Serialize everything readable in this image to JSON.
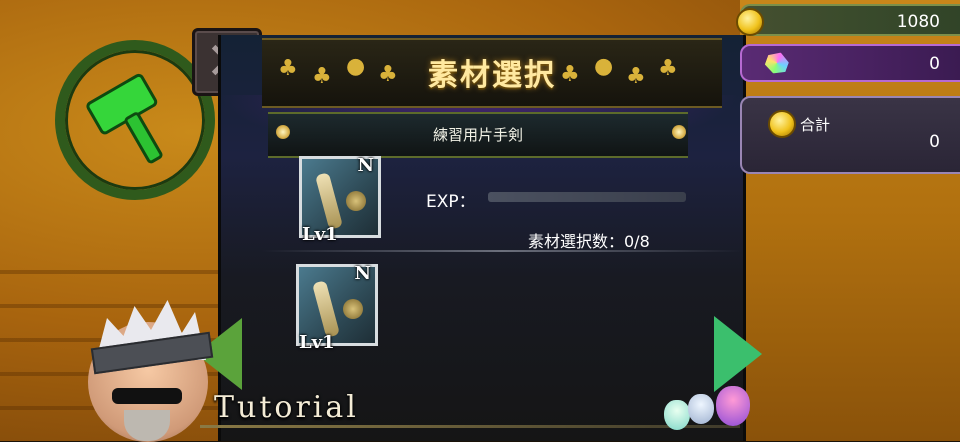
{
  "header": {
    "title": "素材選択",
    "close_icon": "close-icon"
  },
  "subheader": {
    "item_name": "練習用片手剣"
  },
  "items": [
    {
      "rarity": "N",
      "level": "Lv1",
      "exp_label": "EXP：",
      "select_count_label": "素材選択数：0/8"
    },
    {
      "rarity": "N",
      "level": "Lv1"
    }
  ],
  "currencies": {
    "gold": "1080",
    "gems": "0",
    "total_label": "合計",
    "total_value": "0"
  },
  "tutorial_label": "Tutorial",
  "colors": {
    "title_gold": "#ffe9a0",
    "panel_dark": "#181a22",
    "vine_green": "#2f5a1c",
    "hammer_green": "#35d63a"
  }
}
